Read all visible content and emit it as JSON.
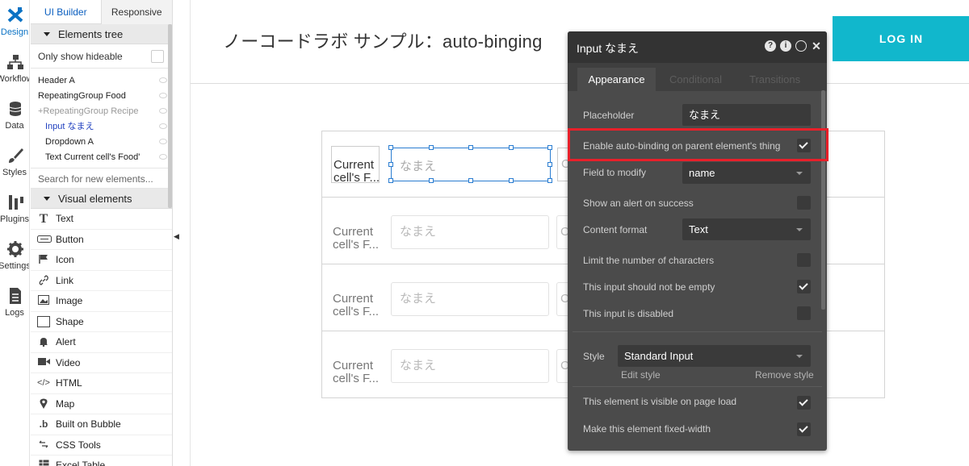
{
  "rail": {
    "items": [
      {
        "label": "Design"
      },
      {
        "label": "Workflow"
      },
      {
        "label": "Data"
      },
      {
        "label": "Styles"
      },
      {
        "label": "Plugins"
      },
      {
        "label": "Settings"
      },
      {
        "label": "Logs"
      }
    ]
  },
  "panel": {
    "tabs": [
      "UI Builder",
      "Responsive"
    ],
    "elements_tree_label": "Elements tree",
    "only_hideable_label": "Only show hideable",
    "tree": [
      "Header A",
      "RepeatingGroup Food",
      "+RepeatingGroup Recipe",
      "Input なまえ",
      "Dropdown A",
      "Text Current cell's Food'"
    ],
    "search_placeholder": "Search for new elements...",
    "visual_elements_label": "Visual elements",
    "visual_items": [
      {
        "label": "Text",
        "icon": "text-icon"
      },
      {
        "label": "Button",
        "icon": "button-icon"
      },
      {
        "label": "Icon",
        "icon": "flag-icon"
      },
      {
        "label": "Link",
        "icon": "link-icon"
      },
      {
        "label": "Image",
        "icon": "image-icon"
      },
      {
        "label": "Shape",
        "icon": "shape-icon"
      },
      {
        "label": "Alert",
        "icon": "bell-icon"
      },
      {
        "label": "Video",
        "icon": "video-icon"
      },
      {
        "label": "HTML",
        "icon": "code-icon"
      },
      {
        "label": "Map",
        "icon": "map-pin-icon"
      },
      {
        "label": "Built on Bubble",
        "icon": "bubble-icon"
      },
      {
        "label": "CSS Tools",
        "icon": "css-icon"
      },
      {
        "label": "Excel Table",
        "icon": "table-icon"
      }
    ]
  },
  "canvas": {
    "title": "ノーコードラボ サンプル：auto-binging",
    "login_label": "LOG IN",
    "cell_text": "Current cell's F...",
    "input_placeholder": "なまえ",
    "dropdown_stub": "C"
  },
  "editor": {
    "title": "Input なまえ",
    "tabs": [
      "Appearance",
      "Conditional",
      "Transitions"
    ],
    "placeholder_label": "Placeholder",
    "placeholder_value": "なまえ",
    "auto_binding_label": "Enable auto-binding on parent element's thing",
    "field_label": "Field to modify",
    "field_value": "name",
    "alert_label": "Show an alert on success",
    "format_label": "Content format",
    "format_value": "Text",
    "limit_label": "Limit the number of characters",
    "not_empty_label": "This input should not be empty",
    "disabled_label": "This input is disabled",
    "style_label": "Style",
    "style_value": "Standard Input",
    "edit_style_label": "Edit style",
    "remove_style_label": "Remove style",
    "visible_label": "This element is visible on page load",
    "fixed_width_label": "Make this element fixed-width",
    "checks": {
      "auto_binding": true,
      "alert": false,
      "limit": false,
      "not_empty": true,
      "disabled": false,
      "visible": true,
      "fixed_width": true
    }
  },
  "colors": {
    "accent_blue": "#0a72c4",
    "login_bg": "#11b7cc",
    "editor_bg": "#4b4b4b",
    "highlight": "#e8202a"
  }
}
